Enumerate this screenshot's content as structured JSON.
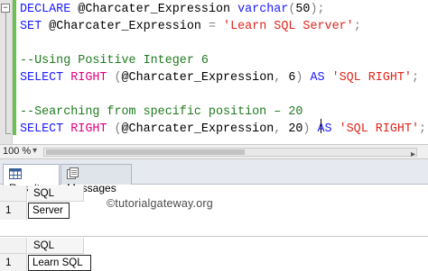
{
  "editor": {
    "collapse_glyph": "−",
    "lines": [
      [
        {
          "t": "DECLARE ",
          "c": "kw"
        },
        {
          "t": "@Charcater_Expression ",
          "c": "id"
        },
        {
          "t": "varchar",
          "c": "kw"
        },
        {
          "t": "(",
          "c": "gr"
        },
        {
          "t": "50",
          "c": "id"
        },
        {
          "t": ");",
          "c": "gr"
        }
      ],
      [
        {
          "t": "SET ",
          "c": "kw"
        },
        {
          "t": "@Charcater_Expression ",
          "c": "id"
        },
        {
          "t": "= ",
          "c": "gr"
        },
        {
          "t": "'Learn SQL Server'",
          "c": "str"
        },
        {
          "t": ";",
          "c": "gr"
        }
      ],
      [],
      [
        {
          "t": "--Using Positive Integer 6",
          "c": "cmt"
        }
      ],
      [
        {
          "t": "SELECT ",
          "c": "kw"
        },
        {
          "t": "RIGHT ",
          "c": "fn"
        },
        {
          "t": "(",
          "c": "gr"
        },
        {
          "t": "@Charcater_Expression",
          "c": "id"
        },
        {
          "t": ", ",
          "c": "gr"
        },
        {
          "t": "6",
          "c": "id"
        },
        {
          "t": ") ",
          "c": "gr"
        },
        {
          "t": "AS ",
          "c": "kw"
        },
        {
          "t": "'SQL RIGHT'",
          "c": "str"
        },
        {
          "t": ";",
          "c": "gr"
        }
      ],
      [],
      [
        {
          "t": "--Searching from specific position – 20",
          "c": "cmt"
        }
      ],
      [
        {
          "t": "SELECT ",
          "c": "kw"
        },
        {
          "t": "RIGHT ",
          "c": "fn"
        },
        {
          "t": "(",
          "c": "gr"
        },
        {
          "t": "@Charcater_Expression",
          "c": "id"
        },
        {
          "t": ", ",
          "c": "gr"
        },
        {
          "t": "20",
          "c": "id"
        },
        {
          "t": ") ",
          "c": "gr"
        },
        {
          "t": "AS ",
          "c": "kw"
        },
        {
          "t": "'SQL RIGHT'",
          "c": "str"
        },
        {
          "t": ";",
          "c": "gr"
        }
      ]
    ]
  },
  "status": {
    "zoom": "100 %",
    "zoom_arrow": "▾",
    "scroll_right_arrow": "▸"
  },
  "results": {
    "tabs": [
      {
        "label": "Results",
        "icon": "grid-icon",
        "active": true
      },
      {
        "label": "Messages",
        "icon": "messages-icon",
        "active": false
      }
    ],
    "grids": [
      {
        "column": "SQL RIGHT",
        "row_number": "1",
        "value": "Server"
      },
      {
        "column": "SQL RIGHT",
        "row_number": "1",
        "value": "Learn SQL Server"
      }
    ],
    "watermark": "©tutorialgateway.org"
  },
  "colors": {
    "keyword": "#1a1aff",
    "function": "#e0007f",
    "string": "#e0261c",
    "comment": "#1f7a1f",
    "change_bar": "#6cbf55"
  }
}
